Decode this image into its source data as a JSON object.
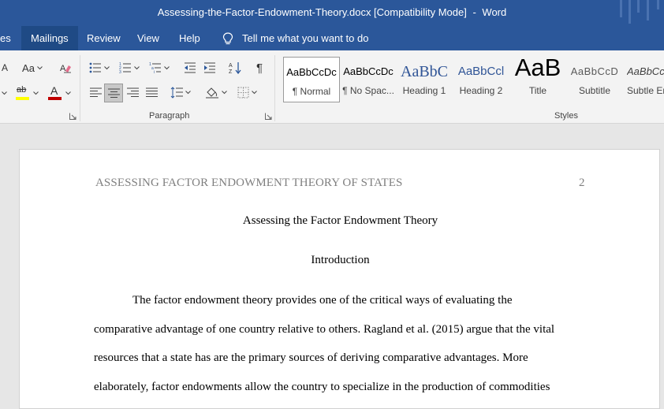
{
  "window": {
    "title": "Assessing-the-Factor-Endowment-Theory.docx [Compatibility Mode]",
    "title_sep": "-",
    "app_name": "Word",
    "accent_color": "#2b579a"
  },
  "ribbon_tabs": {
    "partial_tab": "es",
    "mailings": "Mailings",
    "review": "Review",
    "view": "View",
    "help": "Help",
    "tell_me": "Tell me what you want to do",
    "tell_me_icon": "lightbulb-icon",
    "active": "Mailings"
  },
  "font_group": {
    "partial_label_1": "A",
    "change_case": "Aa",
    "change_case_icon": "change-case-icon",
    "clear_formatting_icon": "clear-formatting-icon",
    "highlight": "ab",
    "highlight_color": "#ffff00",
    "font_color": "A",
    "font_color_value": "#c00000"
  },
  "paragraph_group": {
    "label": "Paragraph",
    "show_marks": "¶",
    "icons": [
      "bullets-icon",
      "numbering-icon",
      "multilevel-list-icon",
      "decrease-indent-icon",
      "increase-indent-icon",
      "sort-icon",
      "show-marks-icon",
      "align-left-icon",
      "align-center-icon",
      "align-right-icon",
      "justify-icon",
      "line-spacing-icon",
      "shading-icon",
      "borders-icon"
    ],
    "selected_alignment": "center"
  },
  "styles_group": {
    "label": "Styles",
    "items": [
      {
        "preview": "AaBbCcDc",
        "name": "¶ Normal",
        "selected": true
      },
      {
        "preview": "AaBbCcDc",
        "name": "¶ No Spac..."
      },
      {
        "preview": "AaBbC",
        "name": "Heading 1"
      },
      {
        "preview": "AaBbCcl",
        "name": "Heading 2"
      },
      {
        "preview": "AaB",
        "name": "Title"
      },
      {
        "preview": "AaBbCcD",
        "name": "Subtitle"
      },
      {
        "preview": "AaBbCcD",
        "name": "Subtle Er"
      }
    ]
  },
  "document": {
    "running_head": "ASSESSING FACTOR ENDOWMENT THEORY OF STATES",
    "page_number": "2",
    "title": "Assessing the Factor Endowment Theory",
    "heading": "Introduction",
    "paragraph_lines": [
      "The factor endowment theory provides one of the critical ways of evaluating the",
      "comparative advantage of one country relative to others. Ragland et al. (2015) argue that the vital",
      "resources that a state has are the primary sources of deriving comparative advantages. More",
      "elaborately, factor endowments allow the country to specialize in the production of commodities"
    ]
  }
}
